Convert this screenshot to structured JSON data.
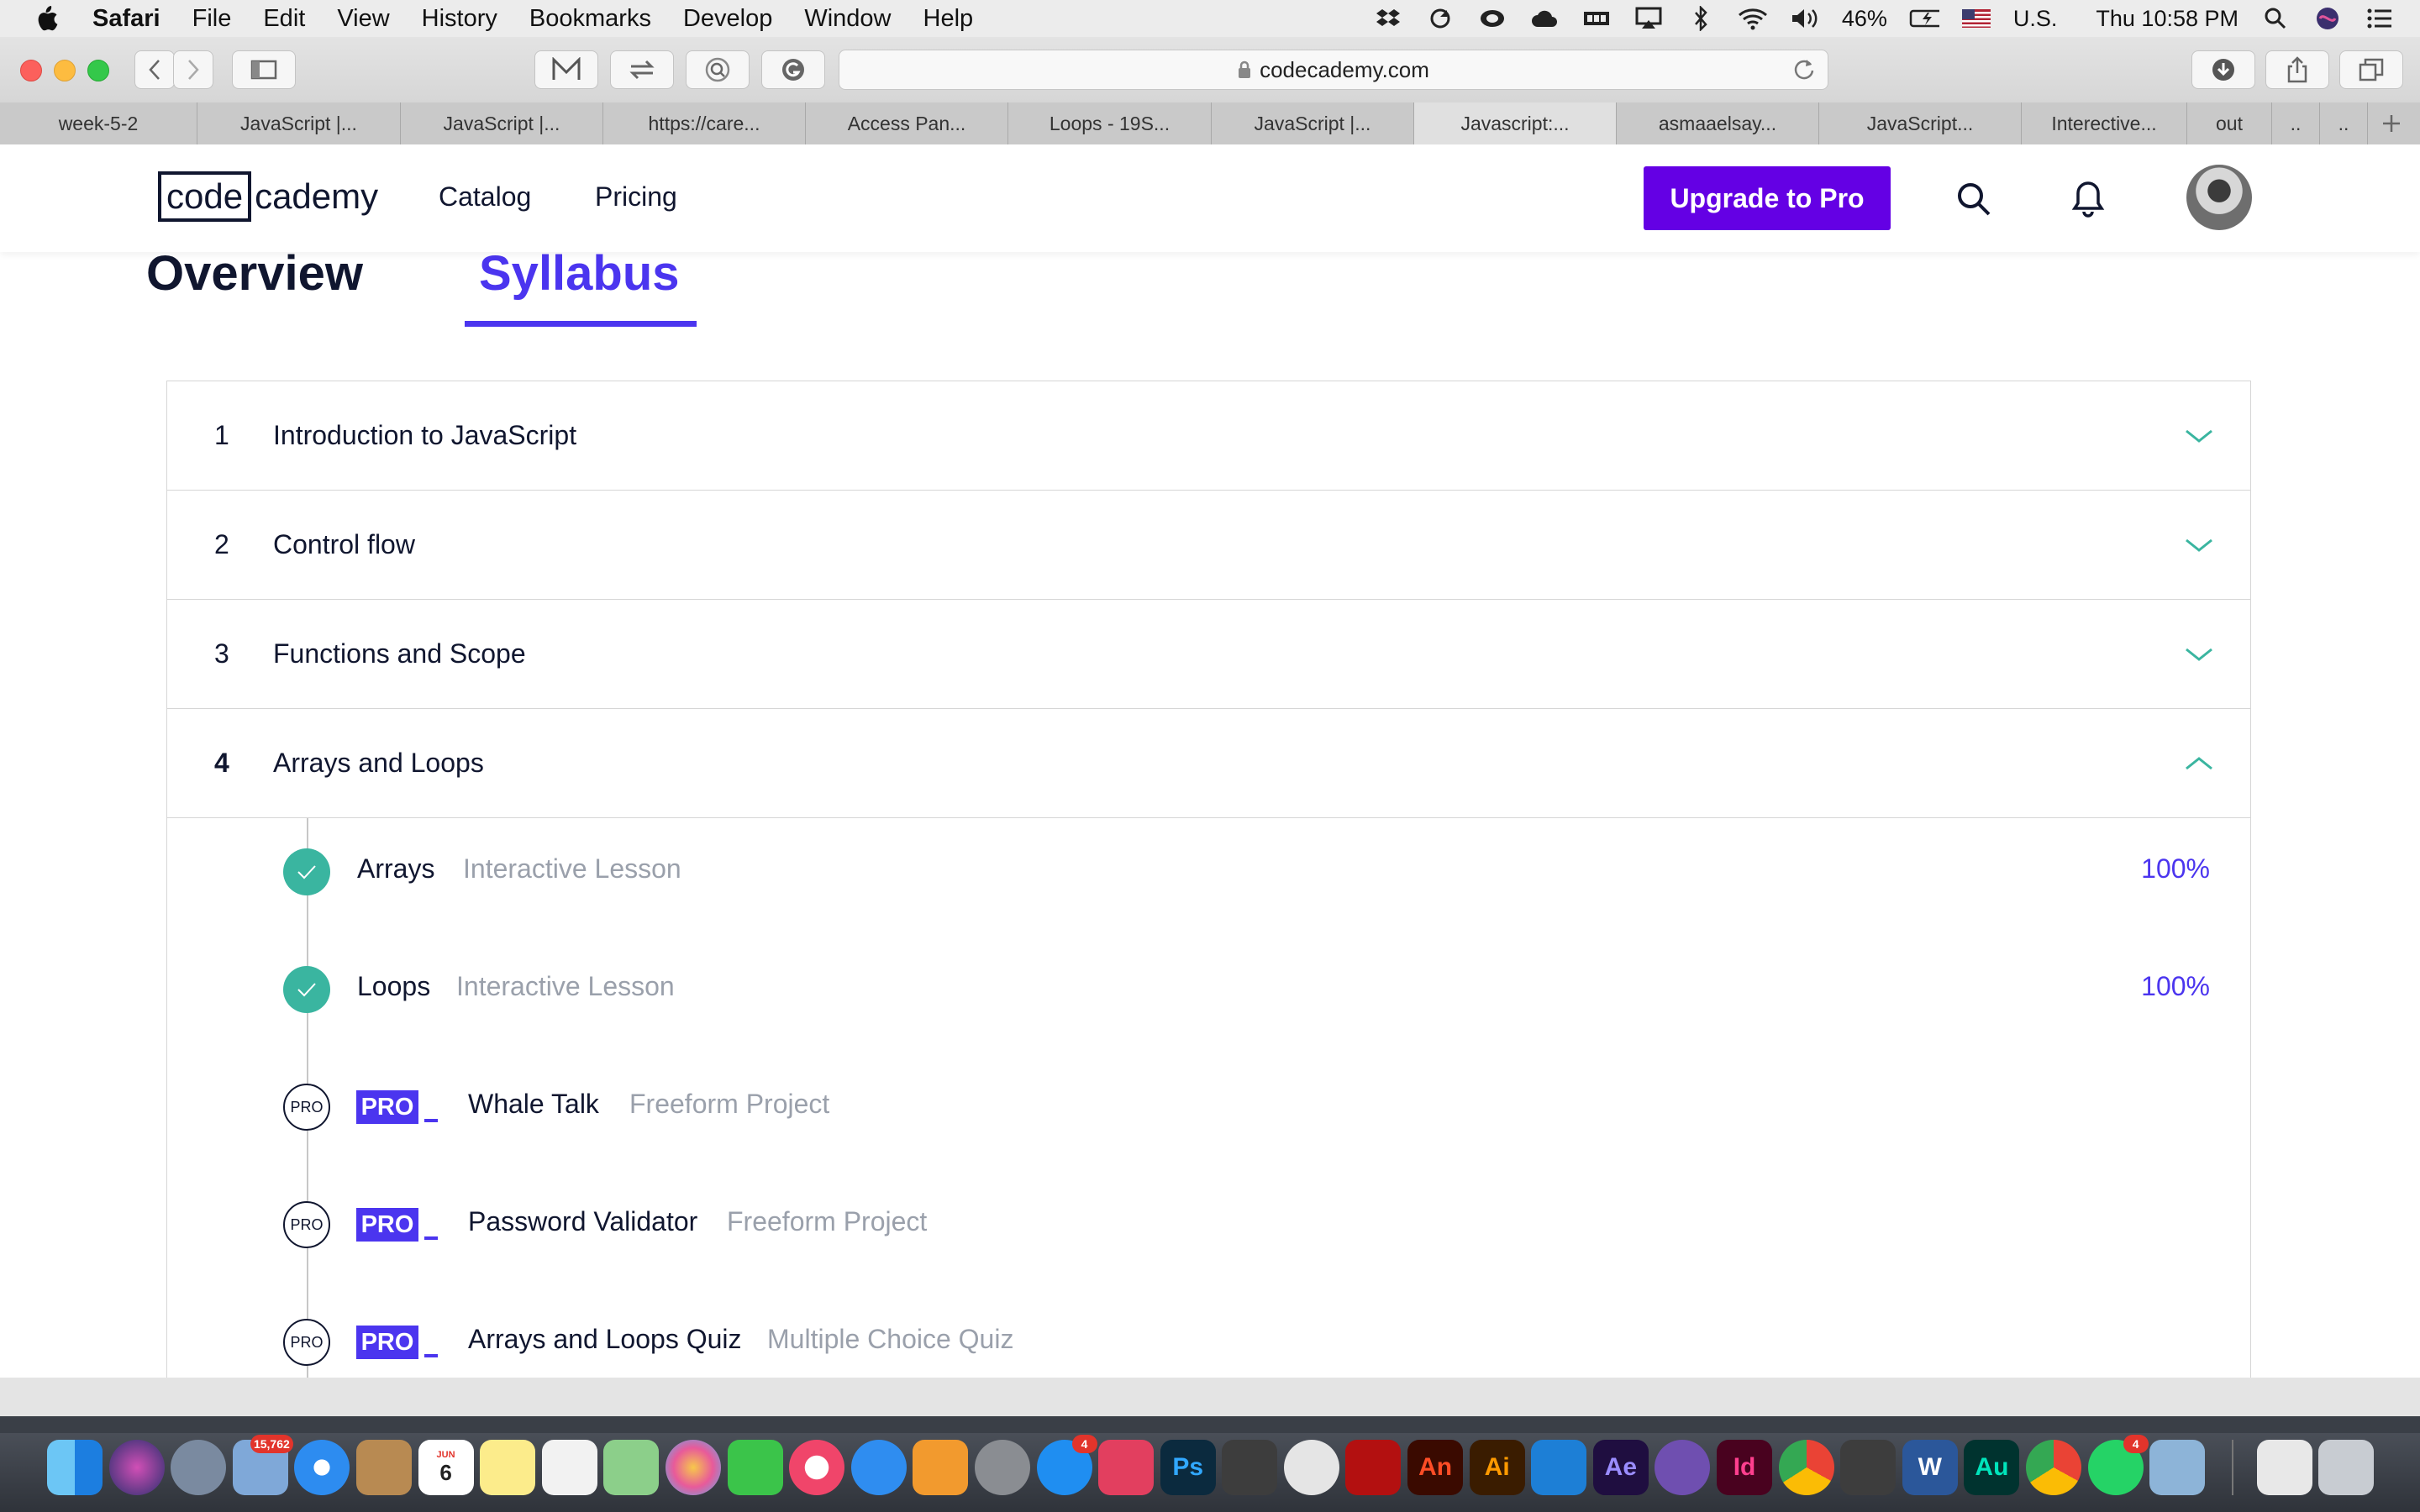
{
  "menubar": {
    "app_name": "Safari",
    "items": [
      "File",
      "Edit",
      "View",
      "History",
      "Bookmarks",
      "Develop",
      "Window",
      "Help"
    ],
    "battery": "46%",
    "input_source": "U.S.",
    "clock": "Thu 10:58 PM"
  },
  "browser": {
    "url": "codecademy.com",
    "tabs": [
      {
        "label": "week-5-2"
      },
      {
        "label": "JavaScript |..."
      },
      {
        "label": "JavaScript |..."
      },
      {
        "label": "https://care..."
      },
      {
        "label": "Access Pan..."
      },
      {
        "label": "Loops - 19S..."
      },
      {
        "label": "JavaScript |..."
      },
      {
        "label": "Javascript:..."
      },
      {
        "label": "asmaaelsay..."
      },
      {
        "label": "JavaScript..."
      },
      {
        "label": "Interective..."
      },
      {
        "label": "out"
      },
      {
        "label": ".."
      },
      {
        "label": ".."
      }
    ],
    "active_tab": 7
  },
  "site": {
    "logo_box": "code",
    "logo_rest": "cademy",
    "nav": {
      "catalog": "Catalog",
      "pricing": "Pricing"
    },
    "upgrade_label": "Upgrade to Pro"
  },
  "page_tabs": {
    "overview": "Overview",
    "syllabus": "Syllabus"
  },
  "syllabus": {
    "units": [
      {
        "num": "1",
        "title": "Introduction to JavaScript",
        "expanded": false
      },
      {
        "num": "2",
        "title": "Control flow",
        "expanded": false
      },
      {
        "num": "3",
        "title": "Functions and Scope",
        "expanded": false
      },
      {
        "num": "4",
        "title": "Arrays and Loops",
        "expanded": true
      }
    ],
    "lessons": [
      {
        "name": "Arrays",
        "type": "Interactive Lesson",
        "progress": "100%",
        "status": "done"
      },
      {
        "name": "Loops",
        "type": "Interactive Lesson",
        "progress": "100%",
        "status": "done"
      },
      {
        "name": "Whale Talk",
        "type": "Freeform Project",
        "status": "pro",
        "mark": "PRO",
        "badge": "PRO"
      },
      {
        "name": "Password Validator",
        "type": "Freeform Project",
        "status": "pro",
        "mark": "PRO",
        "badge": "PRO"
      },
      {
        "name": "Arrays and Loops Quiz",
        "type": "Multiple Choice Quiz",
        "status": "pro",
        "mark": "PRO",
        "badge": "PRO"
      }
    ]
  },
  "colors": {
    "brand_purple": "#6400e4",
    "accent_blue": "#4b35ef",
    "complete_teal": "#3ab5a0",
    "navy": "#10162f"
  },
  "dock": {
    "badges": {
      "photos_app": "15,762",
      "calendar_day": "6",
      "calendar_month": "JUN",
      "app_store": "4",
      "whatsapp": "4"
    },
    "labels": {
      "ps": "Ps",
      "an": "An",
      "ai": "Ai",
      "ae": "Ae",
      "id": "Id",
      "au": "Au",
      "w": "W"
    }
  }
}
